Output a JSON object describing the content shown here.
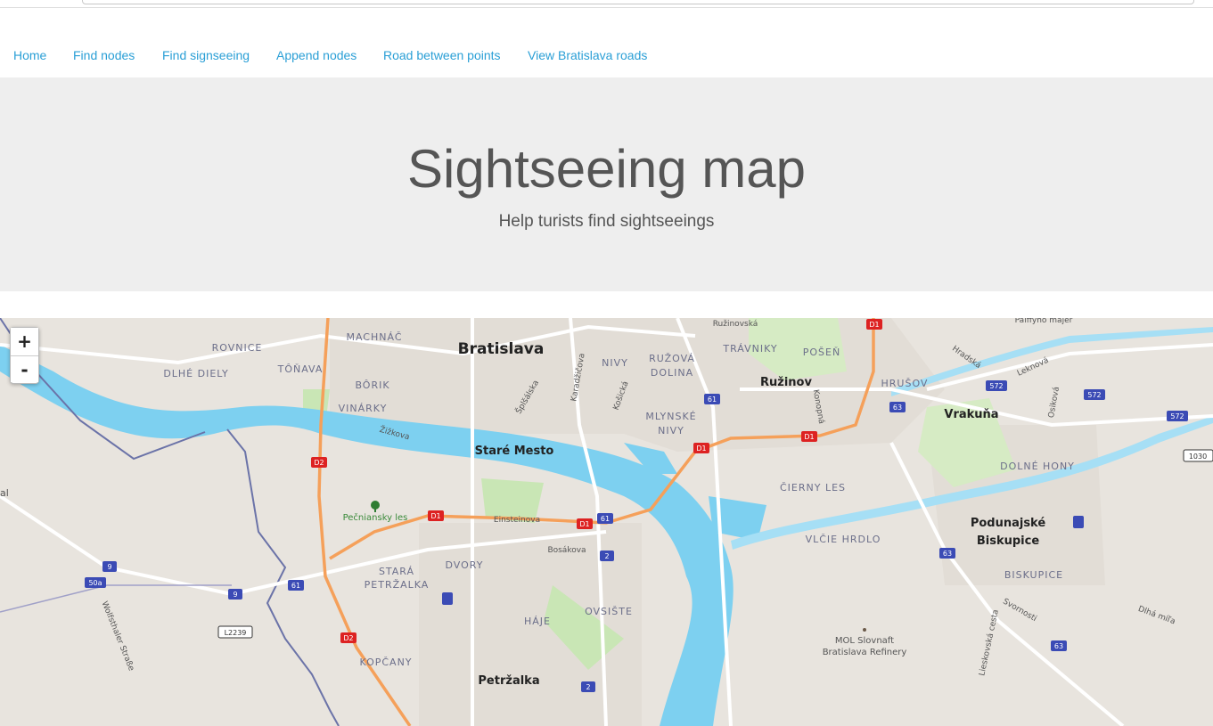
{
  "nav": {
    "items": [
      {
        "label": "Home"
      },
      {
        "label": "Find nodes"
      },
      {
        "label": "Find signseeing"
      },
      {
        "label": "Append nodes"
      },
      {
        "label": "Road between points"
      },
      {
        "label": "View Bratislava roads"
      }
    ]
  },
  "hero": {
    "title": "Sightseeing map",
    "subtitle": "Help turists find sightseeings"
  },
  "map": {
    "zoom_in": "+",
    "zoom_out": "-",
    "colors": {
      "water": "#7dd0f0",
      "land": "#e8e4de",
      "park": "#c9e6b5",
      "motorway": "#f5a05a",
      "major_road": "#ffffff",
      "border": "#6b73a8"
    },
    "labels": {
      "bratislava": "Bratislava",
      "stare_mesto": "Staré Mesto",
      "ruzinov": "Ružinov",
      "vrakuna": "Vrakuňa",
      "petrzalka": "Petržalka",
      "podunajske_1": "Podunajské",
      "podunajske_2": "Biskupice",
      "rovnice": "ROVNICE",
      "machnac": "MACHNÁČ",
      "dlhe_diely": "DLHÉ DIELY",
      "tonava": "TÔŇAVA",
      "borik": "BÔRIK",
      "vinarky": "VINÁRKY",
      "nivy": "NIVY",
      "ruzova_dolina_1": "RUŽOVÁ",
      "ruzova_dolina_2": "DOLINA",
      "trnavky": "TRÁVNIKY",
      "posen": "POŠEŇ",
      "hrusov": "HRUŠOV",
      "mlynske_1": "MLYNSKÉ",
      "mlynske_2": "NIVY",
      "cierny_les": "ČIERNY LES",
      "dolne_hony": "DOLNÉ HONY",
      "vlcie_hrdlo": "VLČIE HRDLO",
      "biskupice": "BISKUPICE",
      "stara_petrzalka_1": "STARÁ",
      "stara_petrzalka_2": "PETRŽALKA",
      "dvory": "DVORY",
      "haje": "HÁJE",
      "ovsiste": "OVSIŠTE",
      "kopcany": "KOPČANY",
      "pecniansky": "Pečniansky les",
      "einsteinova": "Einsteinova",
      "bosakova": "Bosákova",
      "zizkova": "Žižkova",
      "splnalska": "Šplšálska",
      "karadzicova": "Karadžičova",
      "kosicka": "Košická",
      "ruzinovska": "Ružinovská",
      "hradska": "Hradská",
      "leknova": "Leknová",
      "osikova": "Osiková",
      "konopna": "Konopná",
      "palffyho": "Pálffyho majer",
      "svornosti": "Svornosti",
      "dlha_mila": "Dlhá míľa",
      "lieskovska": "Lieskovská cesta",
      "wolfsthaler": "Wolfsthaler Straße",
      "mol_1": "MOL Slovnaft",
      "mol_2": "Bratislava Refinery",
      "vil": "al"
    },
    "shields": {
      "d1": "D1",
      "d2": "D2",
      "r61": "61",
      "r63": "63",
      "r572": "572",
      "r2": "2",
      "r9": "9",
      "r50a": "50a",
      "l2239": "L2239",
      "r1030": "1030"
    }
  }
}
